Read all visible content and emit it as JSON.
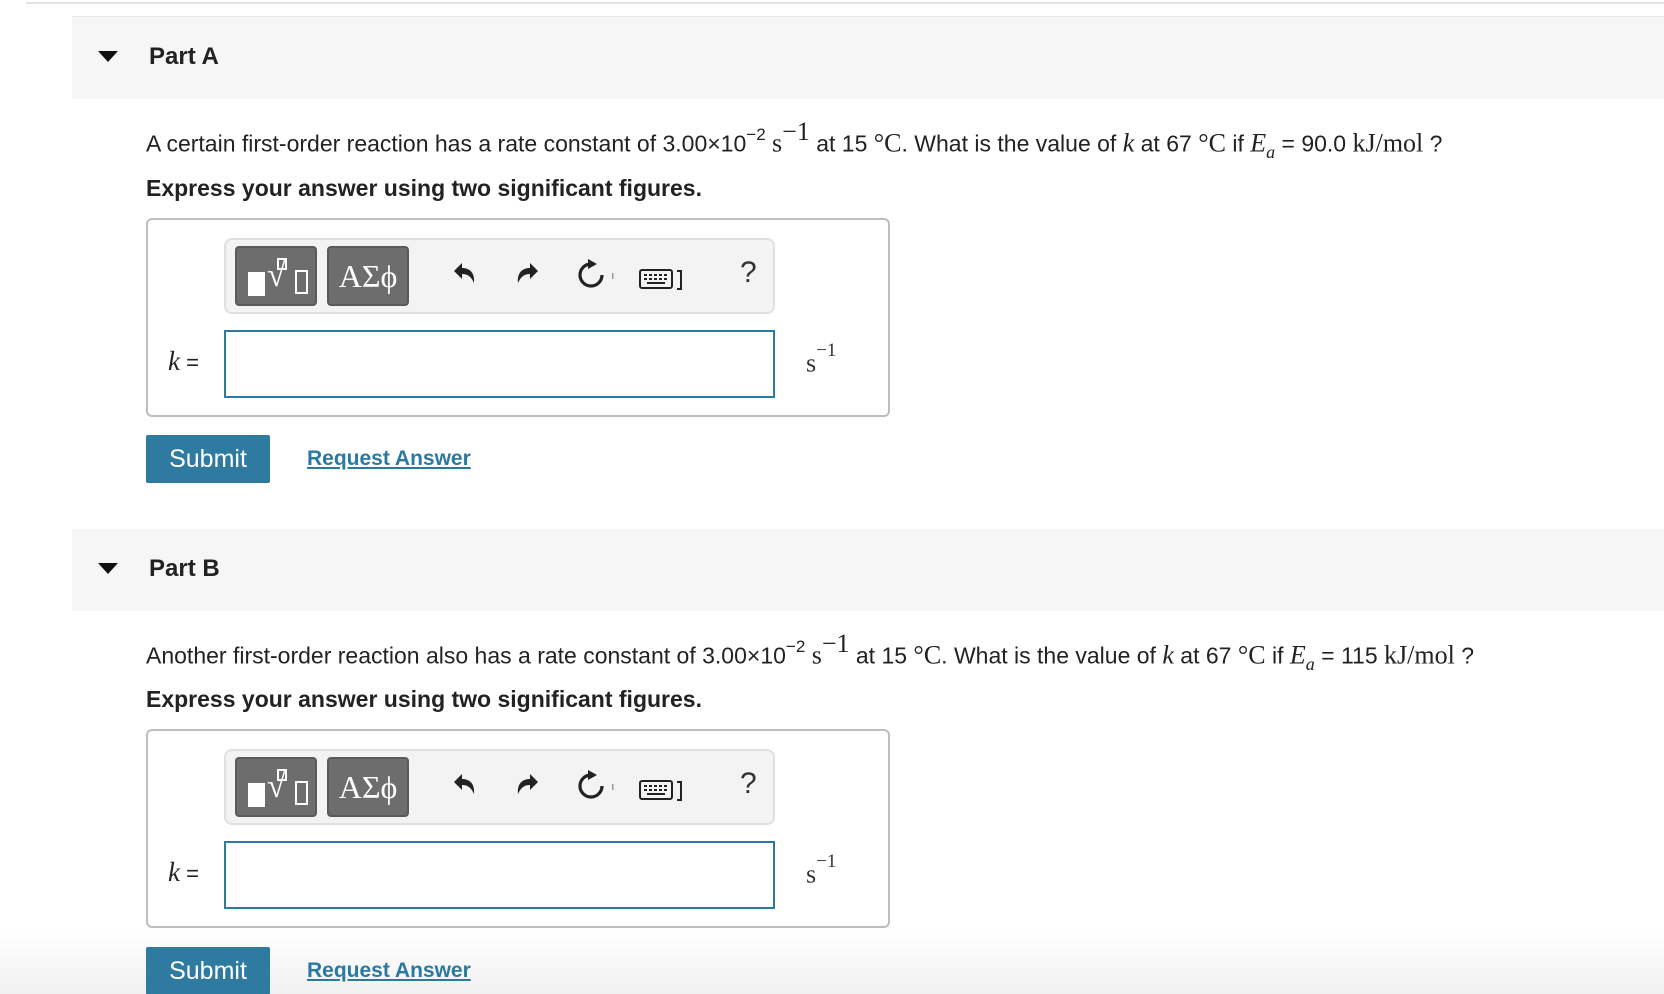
{
  "parts": [
    {
      "title": "Part A",
      "question": {
        "pre": "A certain first-order reaction has a rate constant of 3.00×10",
        "exp": "−2",
        "unit_s": "s",
        "unit_exp": "−1",
        "mid1": " at 15 ",
        "deg": "°C",
        "mid2": ". What is the value of ",
        "k": "k",
        "mid3": " at 67 ",
        "deg2": "°C",
        "mid4": " if ",
        "E": "E",
        "Esub": "a",
        "eq": " = 90.0 ",
        "Eunit": "kJ/mol",
        "end": " ?"
      },
      "instruction": "Express your answer using two significant figures.",
      "toolbar": {
        "greek": "ΑΣϕ",
        "help": "?"
      },
      "answer": {
        "label_var": "k",
        "label_eq": " =",
        "value": "",
        "unit": "s",
        "unit_exp": "−1"
      },
      "submit_label": "Submit",
      "request_label": "Request Answer"
    },
    {
      "title": "Part B",
      "question": {
        "pre": "Another first-order reaction also has a rate constant of 3.00×10",
        "exp": "−2",
        "unit_s": "s",
        "unit_exp": "−1",
        "mid1": " at 15 ",
        "deg": "°C",
        "mid2": ". What is the value of ",
        "k": "k",
        "mid3": " at 67 ",
        "deg2": "°C",
        "mid4": " if ",
        "E": "E",
        "Esub": "a",
        "eq": " = 115 ",
        "Eunit": "kJ/mol",
        "end": " ?"
      },
      "instruction": "Express your answer using two significant figures.",
      "toolbar": {
        "greek": "ΑΣϕ",
        "help": "?"
      },
      "answer": {
        "label_var": "k",
        "label_eq": " =",
        "value": "",
        "unit": "s",
        "unit_exp": "−1"
      },
      "submit_label": "Submit",
      "request_label": "Request Answer"
    }
  ],
  "icons": [
    "caret-down-icon",
    "templates-icon",
    "greek-letters-icon",
    "undo-icon",
    "redo-icon",
    "reset-icon",
    "keyboard-icon",
    "help-icon"
  ],
  "colors": {
    "accent": "#2e7aa0",
    "header_bg": "#f6f6f6",
    "input_border": "#2b7ba0",
    "toolbar_button": "#6d6d6d"
  }
}
